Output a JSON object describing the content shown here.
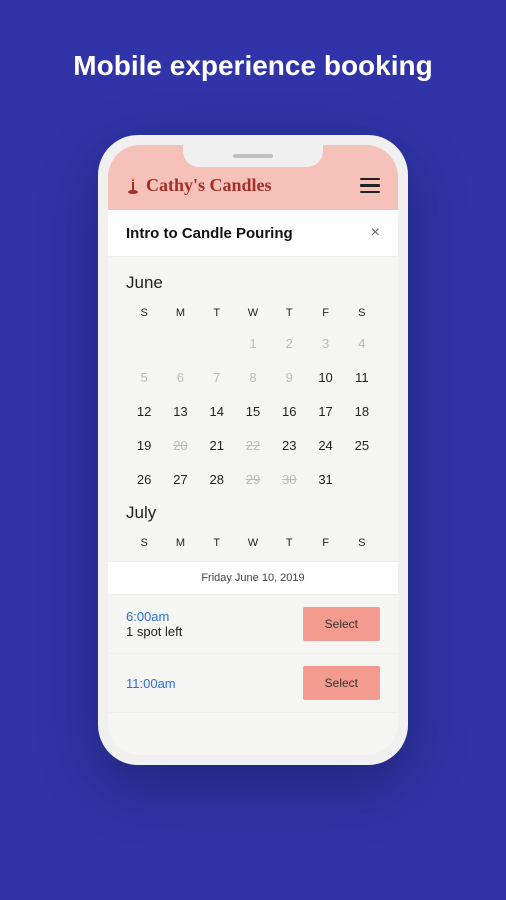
{
  "page": {
    "heading": "Mobile experience booking"
  },
  "header": {
    "brand": "Cathy's Candles"
  },
  "titleBar": {
    "title": "Intro to Candle Pouring",
    "close": "×"
  },
  "months": {
    "june": "June",
    "july": "July"
  },
  "dow": [
    "S",
    "M",
    "T",
    "W",
    "T",
    "F",
    "S"
  ],
  "juneGrid": [
    [
      {
        "n": "",
        "cls": ""
      },
      {
        "n": "",
        "cls": ""
      },
      {
        "n": "",
        "cls": ""
      },
      {
        "n": "1",
        "cls": "faded"
      },
      {
        "n": "2",
        "cls": "faded"
      },
      {
        "n": "3",
        "cls": "faded"
      },
      {
        "n": "4",
        "cls": "faded"
      }
    ],
    [
      {
        "n": "5",
        "cls": "faded"
      },
      {
        "n": "6",
        "cls": "faded"
      },
      {
        "n": "7",
        "cls": "faded"
      },
      {
        "n": "8",
        "cls": "faded"
      },
      {
        "n": "9",
        "cls": "faded"
      },
      {
        "n": "10",
        "cls": "selected"
      },
      {
        "n": "11",
        "cls": ""
      }
    ],
    [
      {
        "n": "12",
        "cls": ""
      },
      {
        "n": "13",
        "cls": ""
      },
      {
        "n": "14",
        "cls": ""
      },
      {
        "n": "15",
        "cls": ""
      },
      {
        "n": "16",
        "cls": ""
      },
      {
        "n": "17",
        "cls": ""
      },
      {
        "n": "18",
        "cls": ""
      }
    ],
    [
      {
        "n": "19",
        "cls": ""
      },
      {
        "n": "20",
        "cls": "struck"
      },
      {
        "n": "21",
        "cls": ""
      },
      {
        "n": "22",
        "cls": "struck"
      },
      {
        "n": "23",
        "cls": ""
      },
      {
        "n": "24",
        "cls": ""
      },
      {
        "n": "25",
        "cls": ""
      }
    ],
    [
      {
        "n": "26",
        "cls": ""
      },
      {
        "n": "27",
        "cls": ""
      },
      {
        "n": "28",
        "cls": ""
      },
      {
        "n": "29",
        "cls": "struck"
      },
      {
        "n": "30",
        "cls": "struck"
      },
      {
        "n": "31",
        "cls": ""
      },
      {
        "n": "",
        "cls": ""
      }
    ]
  ],
  "selectedDate": "Friday June 10, 2019",
  "slots": [
    {
      "time": "6:00am",
      "spots": "1 spot left",
      "button": "Select"
    },
    {
      "time": "11:00am",
      "spots": "",
      "button": "Select"
    }
  ]
}
